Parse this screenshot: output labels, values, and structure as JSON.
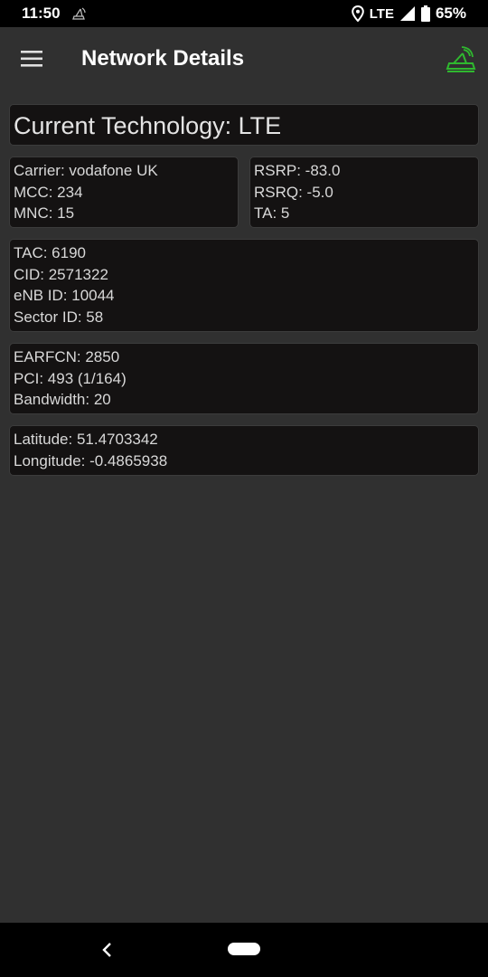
{
  "status_bar": {
    "time": "11:50",
    "network": "LTE",
    "battery": "65%"
  },
  "toolbar": {
    "title": "Network Details"
  },
  "cards": {
    "technology": "Current Technology: LTE",
    "carrier": [
      "Carrier: vodafone UK",
      "MCC: 234",
      "MNC: 15"
    ],
    "signal": [
      "RSRP: -83.0",
      "RSRQ: -5.0",
      "TA: 5"
    ],
    "cell": [
      "TAC: 6190",
      "CID: 2571322",
      "eNB ID: 10044",
      "Sector ID: 58"
    ],
    "channel": [
      "EARFCN: 2850",
      "PCI: 493 (1/164)",
      "Bandwidth: 20"
    ],
    "location": [
      "Latitude: 51.4703342",
      "Longitude: -0.4865938"
    ]
  },
  "icons": {
    "menu": "hamburger-menu-icon",
    "logo": "tower-logo-icon",
    "notification": "signal-tower-icon",
    "location": "location-pin-icon",
    "signal": "cell-signal-icon",
    "battery": "battery-icon",
    "back": "back-chevron-icon",
    "home": "home-pill"
  },
  "colors": {
    "background": "#303030",
    "card": "#141212",
    "accent_green": "#2fb82f",
    "bars": "#000000"
  }
}
